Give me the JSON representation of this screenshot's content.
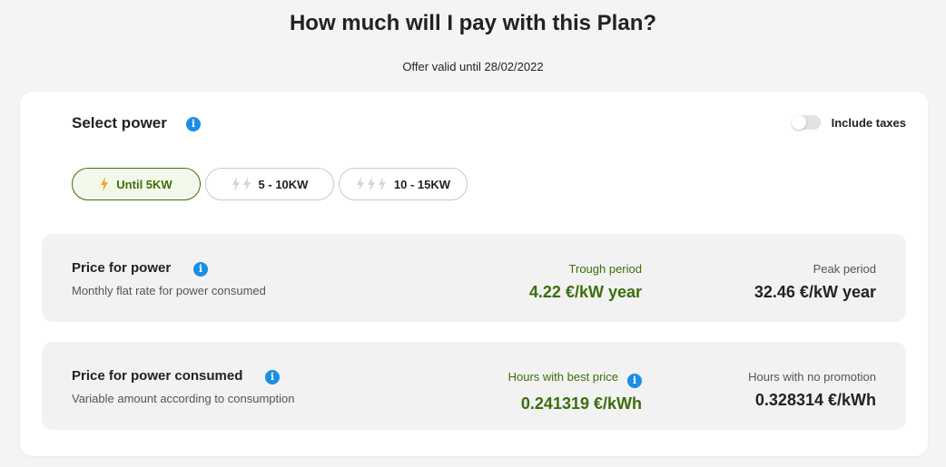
{
  "header": {
    "title": "How much will I pay with this Plan?",
    "offer_valid": "Offer valid until 28/02/2022"
  },
  "power_selector": {
    "title": "Select power",
    "include_taxes_label": "Include taxes",
    "include_taxes_on": false,
    "options": [
      {
        "label": "Until 5KW",
        "bolts": 1,
        "selected": true
      },
      {
        "label": "5 - 10KW",
        "bolts": 2,
        "selected": false
      },
      {
        "label": "10 - 15KW",
        "bolts": 3,
        "selected": false
      }
    ]
  },
  "price_power": {
    "title": "Price for power",
    "subtitle": "Monthly flat rate for power consumed",
    "trough_label": "Trough period",
    "trough_value": "4.22 €/kW year",
    "peak_label": "Peak period",
    "peak_value": "32.46 €/kW year"
  },
  "price_consumed": {
    "title": "Price for power consumed",
    "subtitle": "Variable amount according to consumption",
    "best_label": "Hours with best price",
    "best_value": "0.241319 €/kWh",
    "nopromo_label": "Hours with no promotion",
    "nopromo_value": "0.328314 €/kWh"
  },
  "colors": {
    "accent_green": "#3c6e0a",
    "info_blue": "#1a8fe3",
    "bolt_active": "#f5a623",
    "bolt_inactive": "#d6d6d6"
  },
  "icons": {
    "info": "info-icon",
    "bolt": "lightning-bolt-icon"
  }
}
